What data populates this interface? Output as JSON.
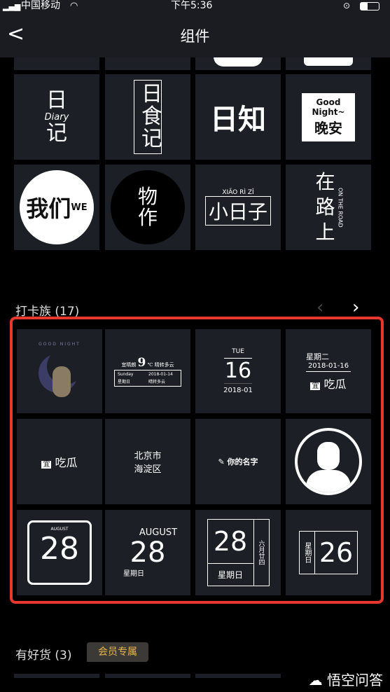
{
  "status": {
    "carrier": "中国移动",
    "time": "下午5:36",
    "icons": [
      "signal-icon",
      "wifi-icon",
      "orientation-lock-icon",
      "battery-icon"
    ]
  },
  "nav": {
    "title": "组件",
    "back_icon": "chevron-left-icon"
  },
  "grid1": [
    {
      "main": "日 记",
      "sub": "Diary"
    },
    {
      "main": "日食记"
    },
    {
      "main": "日知"
    },
    {
      "main": "晚安",
      "sub": "Good Night~"
    },
    {
      "main": "我们",
      "sub": "WE"
    },
    {
      "main": "物作"
    },
    {
      "main": "小日子",
      "sub": "XIÃO RÌ ZǏ"
    },
    {
      "main": "在路上",
      "sub": "ON THE ROAD"
    }
  ],
  "section1": {
    "title": "打卡族 (17)",
    "prev": "‹",
    "next": "›"
  },
  "grid2": {
    "t1": {
      "label": "GOOD NIGHT"
    },
    "t2": {
      "a": "宜晴朗",
      "temp": "9",
      "unit": "℃ 晴转多云",
      "b": "Sunday",
      "c": "星期日",
      "d": "2018-01-14",
      "e": "晴转多云"
    },
    "t3": {
      "day": "TUE",
      "num": "16",
      "date": "2018-01"
    },
    "t4": {
      "week": "星期二",
      "date": "2018-01-16",
      "yi": "宜",
      "text": "吃瓜"
    },
    "t5": {
      "yi": "宜",
      "text": "吃瓜"
    },
    "t6": {
      "l1": "北京市",
      "l2": "海淀区"
    },
    "t7": {
      "text": "你的名字"
    },
    "t8": {
      "icon": "avatar-placeholder-icon"
    },
    "t9": {
      "month": "AUGUST",
      "num": "28"
    },
    "t10": {
      "month": "AUGUST",
      "num": "28",
      "week": "星期日"
    },
    "t11": {
      "num": "28",
      "week": "星期日",
      "lunar": "六月廿四"
    },
    "t12": {
      "week": "星期日",
      "num": "26"
    }
  },
  "section2": {
    "title": "有好货 (3)",
    "badge": "会员专属"
  },
  "watermark": "悟空问答",
  "colors": {
    "highlight": "#e8372e",
    "badge_text": "#e6b54a",
    "tile": "#1d1f27"
  }
}
